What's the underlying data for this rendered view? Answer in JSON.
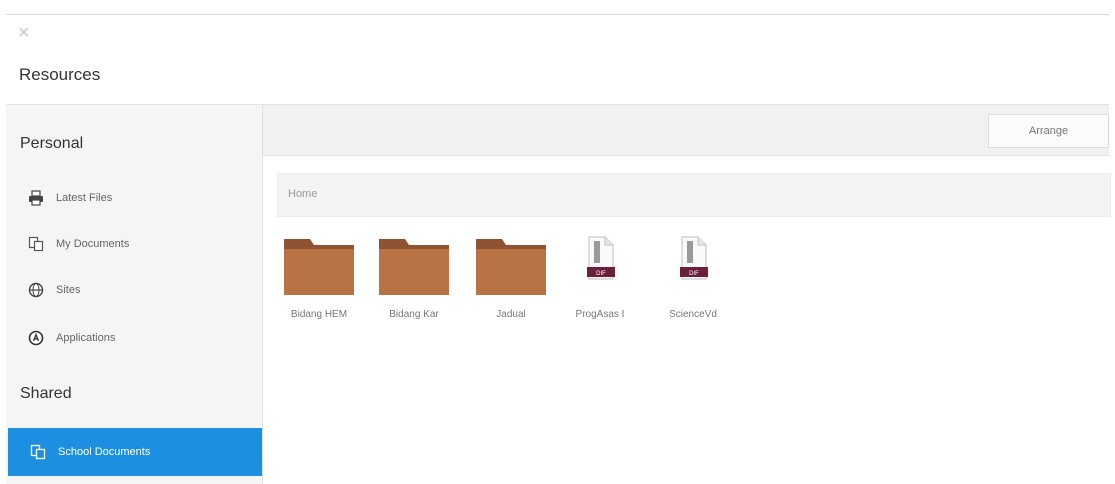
{
  "window": {
    "close_glyph": "×"
  },
  "page_title": "Resources",
  "sidebar": {
    "personal_heading": "Personal",
    "personal_items": [
      {
        "label": "Latest Files",
        "icon": "printer-icon"
      },
      {
        "label": "My Documents",
        "icon": "documents-icon"
      },
      {
        "label": "Sites",
        "icon": "globe-icon"
      },
      {
        "label": "Applications",
        "icon": "apps-icon"
      }
    ],
    "shared_heading": "Shared",
    "shared_items": [
      {
        "label": "School Documents",
        "icon": "documents-icon",
        "active": true
      }
    ]
  },
  "toolbar": {
    "arrange_label": "Arrange"
  },
  "breadcrumb": {
    "path": "Home"
  },
  "files": [
    {
      "name": "Bidang HEM",
      "type": "folder"
    },
    {
      "name": "Bidang Kar",
      "type": "folder"
    },
    {
      "name": "Jadual",
      "type": "folder"
    },
    {
      "name": "ProgAsas I",
      "type": "file",
      "badge": "DIF"
    },
    {
      "name": "ScienceVd",
      "type": "file",
      "badge": "DIF"
    }
  ],
  "colors": {
    "accent": "#1d8fe0",
    "folder": "#b97244",
    "folder_dark": "#8e5330",
    "file_badge": "#6b1f3b"
  }
}
